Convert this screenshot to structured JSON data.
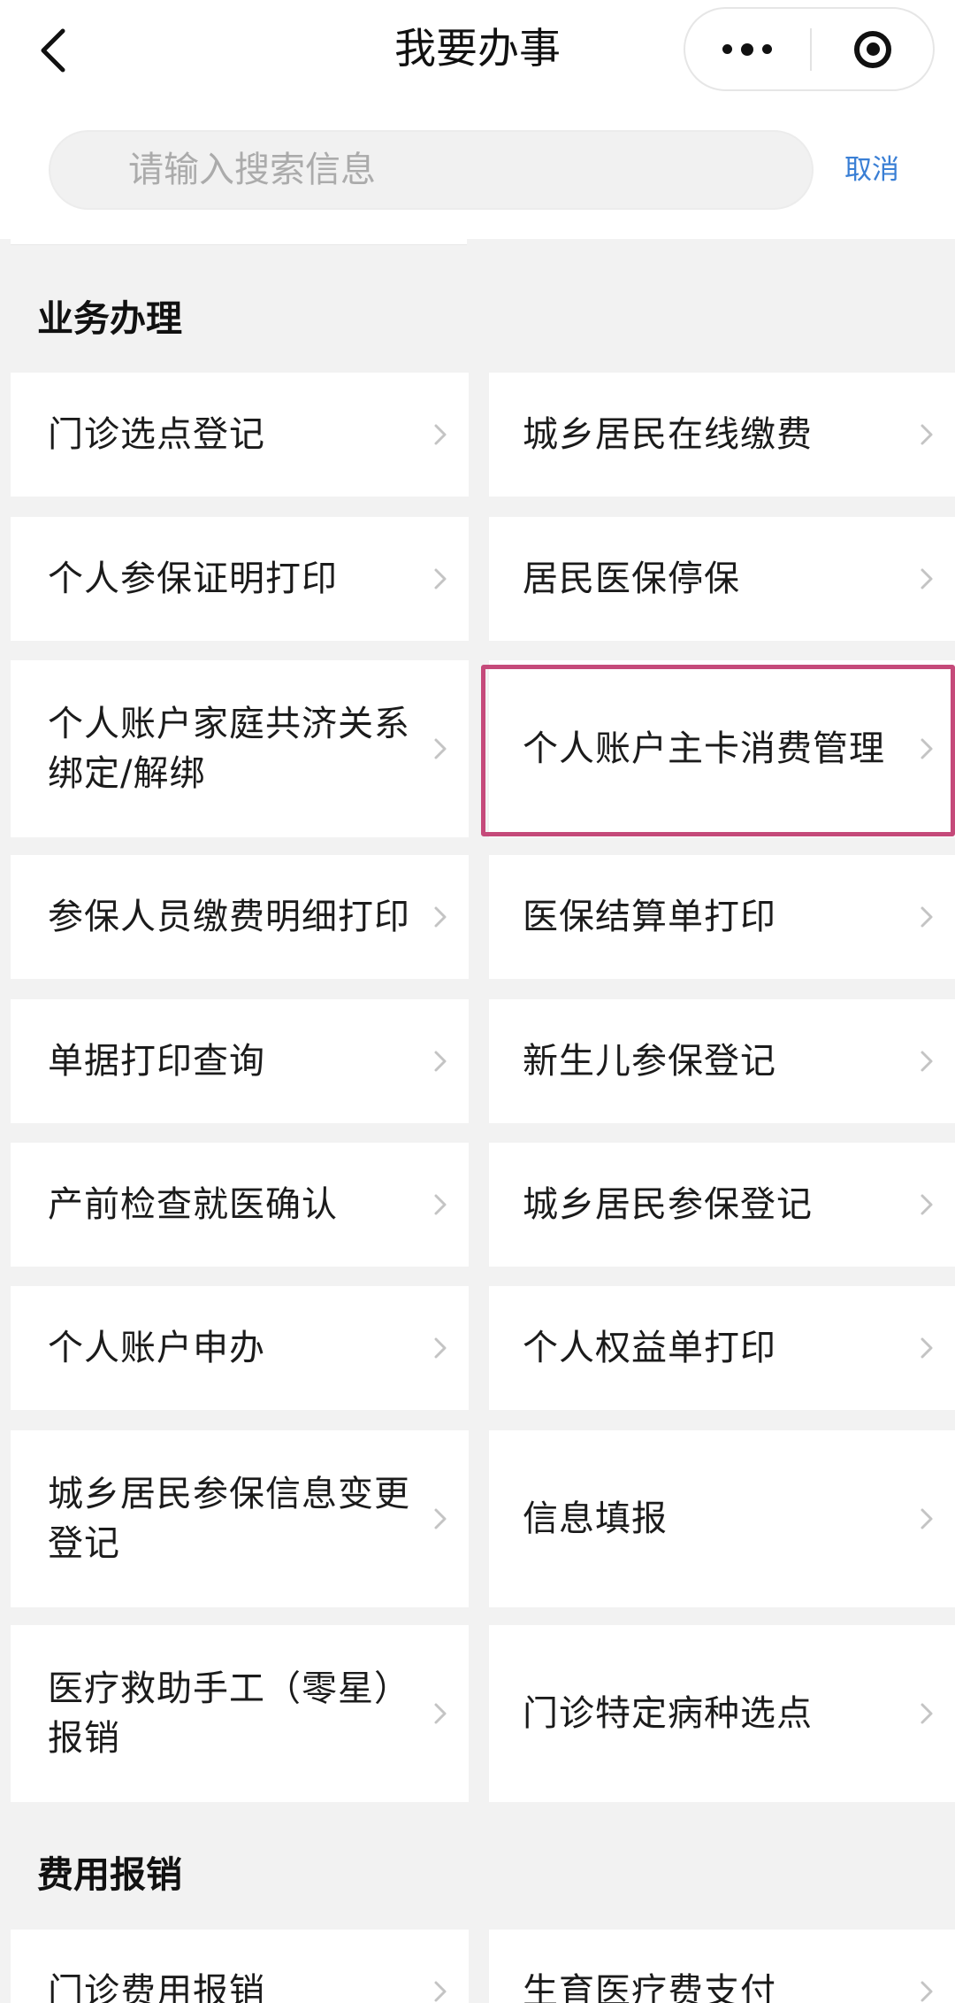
{
  "header": {
    "title": "我要办事",
    "back_icon": "chevron-left-icon",
    "more_icon": "more-dots-icon",
    "close_icon": "target-circle-icon"
  },
  "search": {
    "placeholder": "请输入搜索信息",
    "cancel_label": "取消"
  },
  "sections": [
    {
      "title": "业务办理",
      "items": [
        {
          "label": "门诊选点登记"
        },
        {
          "label": "城乡居民在线缴费"
        },
        {
          "label": "个人参保证明打印"
        },
        {
          "label": "居民医保停保"
        },
        {
          "label": "个人账户家庭共济关系绑定/解绑"
        },
        {
          "label": "个人账户主卡消费管理",
          "highlighted": true
        },
        {
          "label": "参保人员缴费明细打印"
        },
        {
          "label": "医保结算单打印"
        },
        {
          "label": "单据打印查询"
        },
        {
          "label": "新生儿参保登记"
        },
        {
          "label": "产前检查就医确认"
        },
        {
          "label": "城乡居民参保登记"
        },
        {
          "label": "个人账户申办"
        },
        {
          "label": "个人权益单打印"
        },
        {
          "label": "城乡居民参保信息变更登记"
        },
        {
          "label": "信息填报"
        },
        {
          "label": "医疗救助手工（零星）报销"
        },
        {
          "label": "门诊特定病种选点"
        }
      ]
    },
    {
      "title": "费用报销",
      "items": [
        {
          "label": "门诊费用报销"
        },
        {
          "label": "生育医疗费支付"
        }
      ]
    }
  ],
  "colors": {
    "highlight_border": "#c54a7a",
    "cancel_link": "#3a7fd5",
    "background": "#f2f2f2"
  }
}
